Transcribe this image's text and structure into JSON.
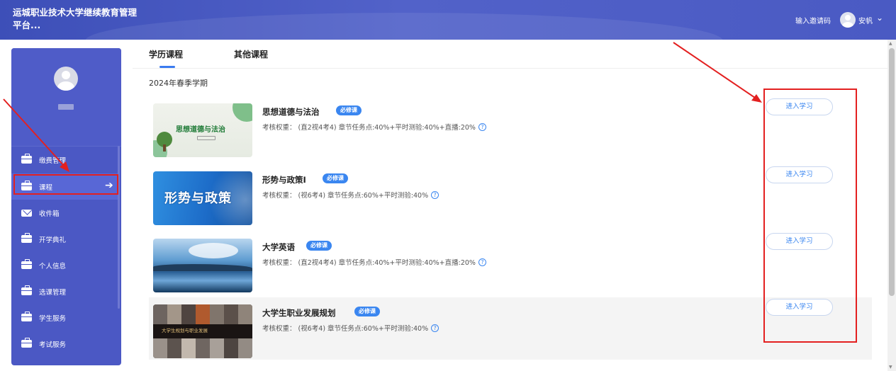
{
  "header": {
    "app_title": "运城职业技术大学继续教育管理平台...",
    "invite_code": "输入邀请码",
    "user_name": "安帆",
    "caret": "⌄"
  },
  "sidebar": {
    "items": [
      {
        "label": "缴费管理",
        "icon": "briefcase-icon"
      },
      {
        "label": "课程",
        "icon": "briefcase-icon",
        "active": true,
        "arrow": "➔"
      },
      {
        "label": "收件箱",
        "icon": "mail-icon"
      },
      {
        "label": "开学典礼",
        "icon": "briefcase-icon"
      },
      {
        "label": "个人信息",
        "icon": "briefcase-icon"
      },
      {
        "label": "选课管理",
        "icon": "briefcase-icon"
      },
      {
        "label": "学生服务",
        "icon": "briefcase-icon"
      },
      {
        "label": "考试服务",
        "icon": "briefcase-icon"
      }
    ]
  },
  "tabs": [
    {
      "label": "学历课程",
      "active": true
    },
    {
      "label": "其他课程",
      "active": false
    }
  ],
  "semester": "2024年春季学期",
  "courses": [
    {
      "name": "思想道德与法治",
      "badge": "必修课",
      "meta": "考核权重： (直2视4考4) 章节任务点:40%+平时测验:40%+直播:20%",
      "button": "进入学习",
      "thumb_text": "思想道德与法治"
    },
    {
      "name": "形势与政策I",
      "badge": "必修课",
      "meta": "考核权重： (视6考4) 章节任务点:60%+平时测验:40%",
      "button": "进入学习",
      "thumb_text": "形势与政策"
    },
    {
      "name": "大学英语",
      "badge": "必修课",
      "meta": "考核权重： (直2视4考4) 章节任务点:40%+平时测验:40%+直播:20%",
      "button": "进入学习",
      "thumb_text": ""
    },
    {
      "name": "大学生职业发展规划",
      "badge": "必修课",
      "meta": "考核权重： (视6考4) 章节任务点:60%+平时测验:40%",
      "button": "进入学习",
      "thumb_text": "大学生规划与职业发展"
    }
  ],
  "help_glyph": "?",
  "colors": {
    "header": "#4a5ac3",
    "sidebar": "#4b58c4",
    "accent": "#3a86f0",
    "annotation": "#e32020"
  }
}
